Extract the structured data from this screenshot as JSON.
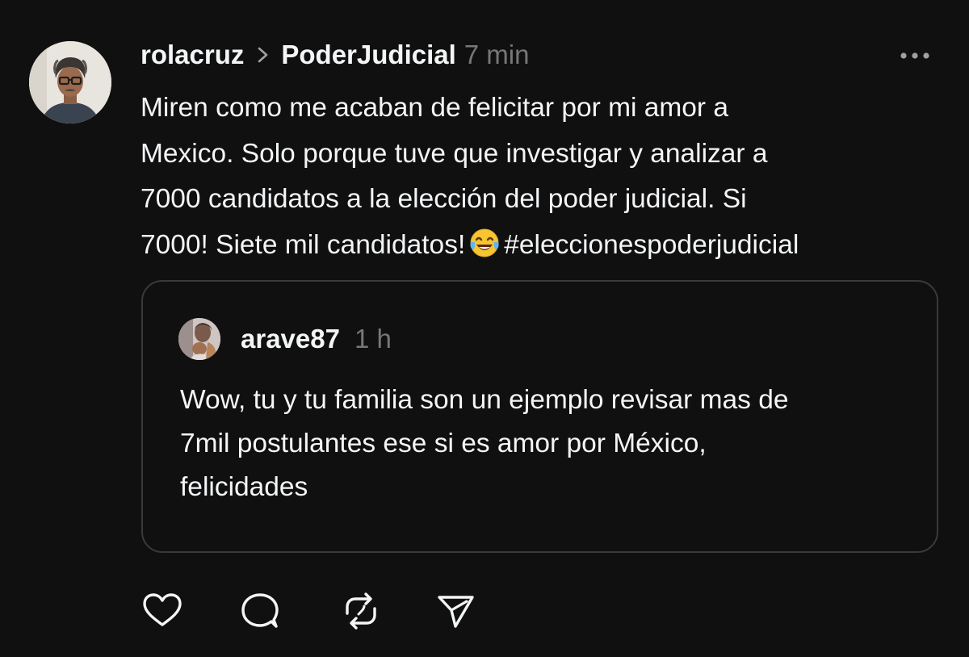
{
  "post": {
    "username": "rolacruz",
    "community": "PoderJudicial",
    "time": "7 min",
    "text_line1": "Miren como me acaban de felicitar por mi amor a",
    "text_line2": "Mexico. Solo porque tuve que investigar y analizar a",
    "text_line3": "7000 candidatos a la elección del poder judicial. Si",
    "text_line4_start": "7000! Siete mil candidatos!",
    "hashtag": "#eleccionespoderjudicial",
    "emoji_name": "face-with-tears-of-joy-emoji"
  },
  "quoted": {
    "username": "arave87",
    "time": "1 h",
    "text_line1": "Wow, tu y tu familia son un ejemplo revisar mas de",
    "text_line2": "7mil postulantes ese si es amor por México,",
    "text_line3": "felicidades"
  },
  "actions": [
    {
      "icon": "heart-icon"
    },
    {
      "icon": "comment-icon"
    },
    {
      "icon": "repost-icon"
    },
    {
      "icon": "share-icon"
    }
  ],
  "colors": {
    "background": "#101010",
    "text": "#f3f5f7",
    "muted": "#777777",
    "border": "#3a3a3a"
  }
}
